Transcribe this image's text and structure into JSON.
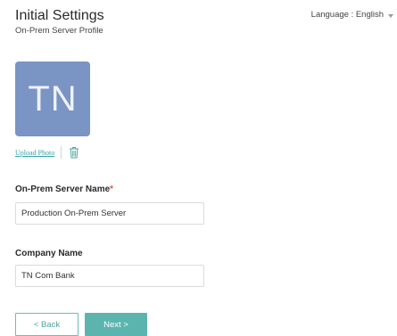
{
  "header": {
    "title": "Initial Settings",
    "subtitle": "On-Prem Server Profile",
    "language_label": "Language : English",
    "language_caret_icon": "chevron-down-icon"
  },
  "profile_photo": {
    "initials": "TN",
    "background_color": "#7a94c4",
    "upload_label": "Upload Photo",
    "delete_icon": "trash-icon"
  },
  "form": {
    "server_name": {
      "label": "On-Prem Server Name",
      "required_mark": "*",
      "value": "Production On-Prem Server"
    },
    "company_name": {
      "label": "Company Name",
      "value": "TN Com Bank"
    }
  },
  "actions": {
    "back_label": "< Back",
    "next_label": "Next >",
    "accent_color": "#5bb5ae"
  }
}
